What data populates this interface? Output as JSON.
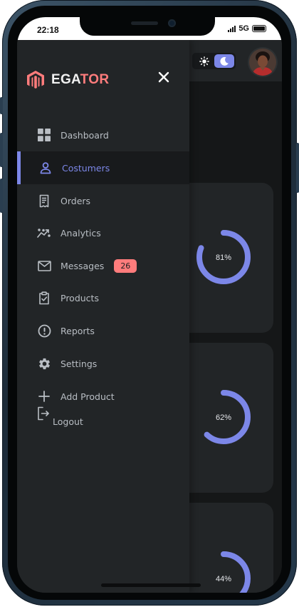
{
  "status_bar": {
    "time": "22:18",
    "network": "5G"
  },
  "brand": {
    "prefix": "EGA",
    "suffix": "TOR"
  },
  "nav": {
    "items": [
      {
        "label": "Dashboard",
        "icon": "grid-icon"
      },
      {
        "label": "Costumers",
        "icon": "person-icon",
        "active": true
      },
      {
        "label": "Orders",
        "icon": "receipt-icon"
      },
      {
        "label": "Analytics",
        "icon": "chart-icon"
      },
      {
        "label": "Messages",
        "icon": "mail-icon",
        "badge": "26"
      },
      {
        "label": "Products",
        "icon": "clipboard-check-icon"
      },
      {
        "label": "Reports",
        "icon": "alert-circle-icon"
      },
      {
        "label": "Settings",
        "icon": "gear-icon"
      },
      {
        "label": "Add Product",
        "icon": "plus-icon"
      }
    ],
    "logout_label": "Logout"
  },
  "cards": [
    {
      "value_label": "81%",
      "percent": 81
    },
    {
      "value_label": "62%",
      "percent": 62
    },
    {
      "value_label": "44%",
      "percent": 44
    }
  ],
  "colors": {
    "accent": "#7c87e8",
    "brand_red": "#ff7c7c",
    "drawer_bg": "#222527",
    "page_bg": "#151718"
  }
}
